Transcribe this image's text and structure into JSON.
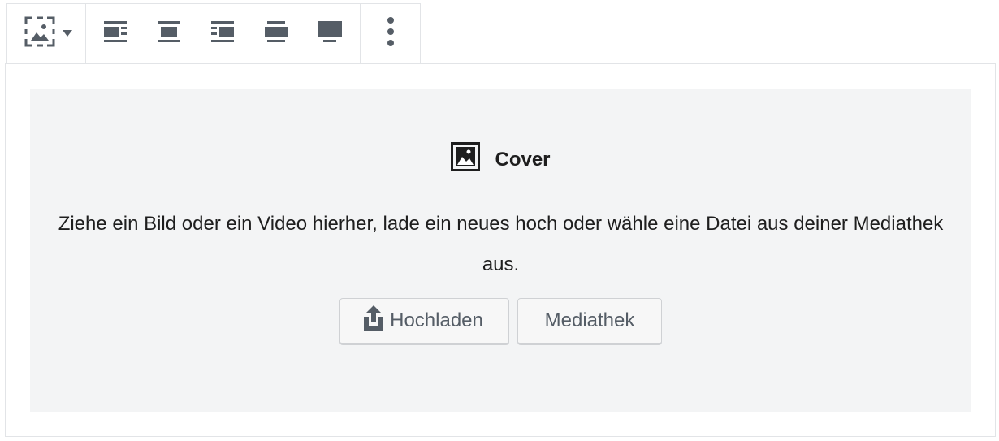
{
  "toolbar": {
    "block_switcher": {
      "icon": "cover-block-icon",
      "dropdown_icon": "caret-down-icon"
    },
    "alignment_buttons": [
      {
        "name": "align-left-button",
        "icon": "align-left-icon"
      },
      {
        "name": "align-center-button",
        "icon": "align-center-icon"
      },
      {
        "name": "align-right-button",
        "icon": "align-right-icon"
      },
      {
        "name": "align-wide-button",
        "icon": "align-wide-icon"
      },
      {
        "name": "align-full-button",
        "icon": "align-full-icon"
      }
    ],
    "more_options_icon": "more-vertical-icon"
  },
  "placeholder": {
    "icon": "image-icon",
    "label": "Cover",
    "instructions": "Ziehe ein Bild oder ein Video hierher, lade ein neues hoch oder wähle eine Datei aus deiner Mediathek aus.",
    "upload_label": "Hochladen",
    "upload_icon": "upload-icon",
    "media_library_label": "Mediathek"
  },
  "colors": {
    "icon": "#555d66",
    "placeholder_bg": "#f3f4f5",
    "border": "#e2e4e7"
  }
}
